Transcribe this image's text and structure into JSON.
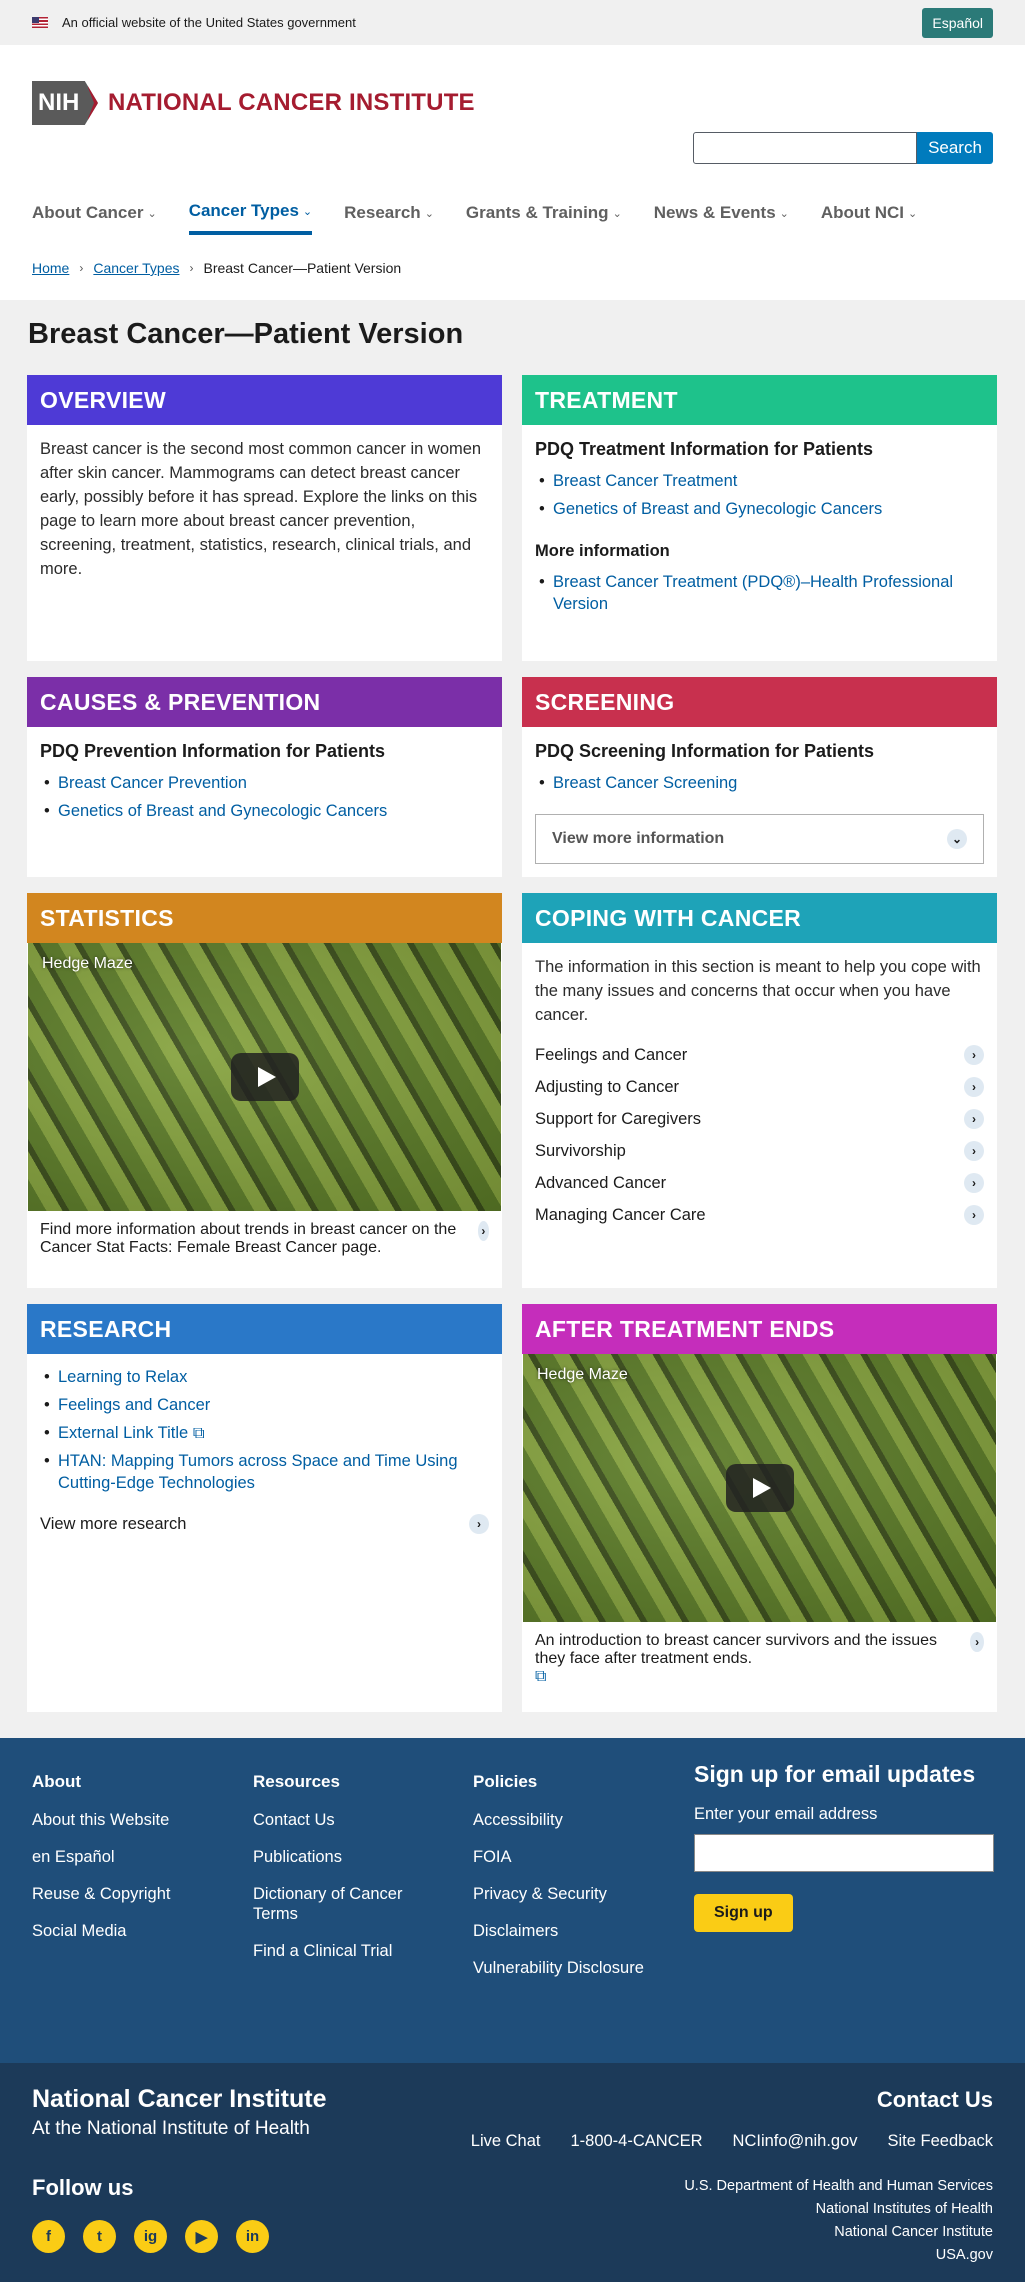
{
  "gov_banner": {
    "text": "An official website of the United States government",
    "espanol": "Español"
  },
  "header": {
    "nih": "NIH",
    "logo_text": "NATIONAL CANCER INSTITUTE",
    "search_label": "Search"
  },
  "nav": [
    "About Cancer",
    "Cancer Types",
    "Research",
    "Grants & Training",
    "News & Events",
    "About NCI"
  ],
  "breadcrumb": {
    "home": "Home",
    "types": "Cancer Types",
    "current": "Breast Cancer—Patient Version"
  },
  "page_title": "Breast Cancer—Patient Version",
  "overview": {
    "title": "OVERVIEW",
    "text": "Breast cancer is the second most common cancer in women after skin cancer. Mammograms can detect breast cancer early, possibly before it has spread. Explore the links on this page to learn more about breast cancer prevention, screening, treatment, statistics, research, clinical trials, and more."
  },
  "treatment": {
    "title": "TREATMENT",
    "subhead": "PDQ Treatment Information for Patients",
    "links": [
      "Breast Cancer Treatment",
      "Genetics of Breast and Gynecologic Cancers"
    ],
    "more_head": "More information",
    "more_link": "Breast Cancer Treatment (PDQ®)–Health Professional Version"
  },
  "causes": {
    "title": "CAUSES & PREVENTION",
    "subhead": "PDQ Prevention Information for Patients",
    "links": [
      "Breast Cancer Prevention",
      "Genetics of Breast and Gynecologic Cancers"
    ]
  },
  "screening": {
    "title": "SCREENING",
    "subhead": "PDQ Screening Information for Patients",
    "links": [
      "Breast Cancer Screening"
    ],
    "expander": "View more information"
  },
  "statistics": {
    "title": "STATISTICS",
    "video_title": "Hedge Maze",
    "caption": "Find more information about trends in breast cancer on the Cancer Stat Facts: Female Breast Cancer page."
  },
  "coping": {
    "title": "COPING WITH CANCER",
    "text": "The information in this section is meant to help you cope with the many issues and concerns that occur when you have cancer.",
    "items": [
      "Feelings and Cancer",
      "Adjusting to Cancer",
      "Support for Caregivers",
      "Survivorship",
      "Advanced Cancer",
      "Managing Cancer Care"
    ]
  },
  "research": {
    "title": "RESEARCH",
    "links": [
      "Learning to Relax",
      "Feelings and Cancer",
      "External Link Title",
      "HTAN: Mapping Tumors across Space and Time Using Cutting-Edge Technologies"
    ],
    "more": "View more research"
  },
  "after": {
    "title": "AFTER TREATMENT ENDS",
    "video_title": "Hedge Maze",
    "caption": "An introduction to breast cancer survivors and the issues they face after treatment ends."
  },
  "footer": {
    "about": {
      "head": "About",
      "links": [
        "About this Website",
        "en Español",
        "Reuse & Copyright",
        "Social Media"
      ]
    },
    "resources": {
      "head": "Resources",
      "links": [
        "Contact Us",
        "Publications",
        "Dictionary of Cancer Terms",
        "Find a Clinical Trial"
      ]
    },
    "policies": {
      "head": "Policies",
      "links": [
        "Accessibility",
        "FOIA",
        "Privacy & Security",
        "Disclaimers",
        "Vulnerability Disclosure"
      ]
    },
    "signup": {
      "head": "Sign up for email updates",
      "label": "Enter your email address",
      "button": "Sign up"
    },
    "org_name": "National Cancer Institute",
    "org_sub": "At the National Institute of Health",
    "follow": "Follow us",
    "socials": [
      "f",
      "t",
      "ig",
      "▶",
      "in"
    ],
    "contact_head": "Contact Us",
    "contact_links": [
      "Live Chat",
      "1-800-4-CANCER",
      "NCIinfo@nih.gov",
      "Site Feedback"
    ],
    "gov_links": [
      "U.S. Department of Health and Human Services",
      "National Institutes of Health",
      "National Cancer Institute",
      "USA.gov"
    ]
  },
  "colors": {
    "overview": "#4e3ad6",
    "treatment": "#1ec28b",
    "causes": "#7b2fa8",
    "screening": "#c8304e",
    "statistics": "#d2861f",
    "coping": "#1ea3b8",
    "research": "#2a78c8",
    "after": "#c52dbb"
  }
}
